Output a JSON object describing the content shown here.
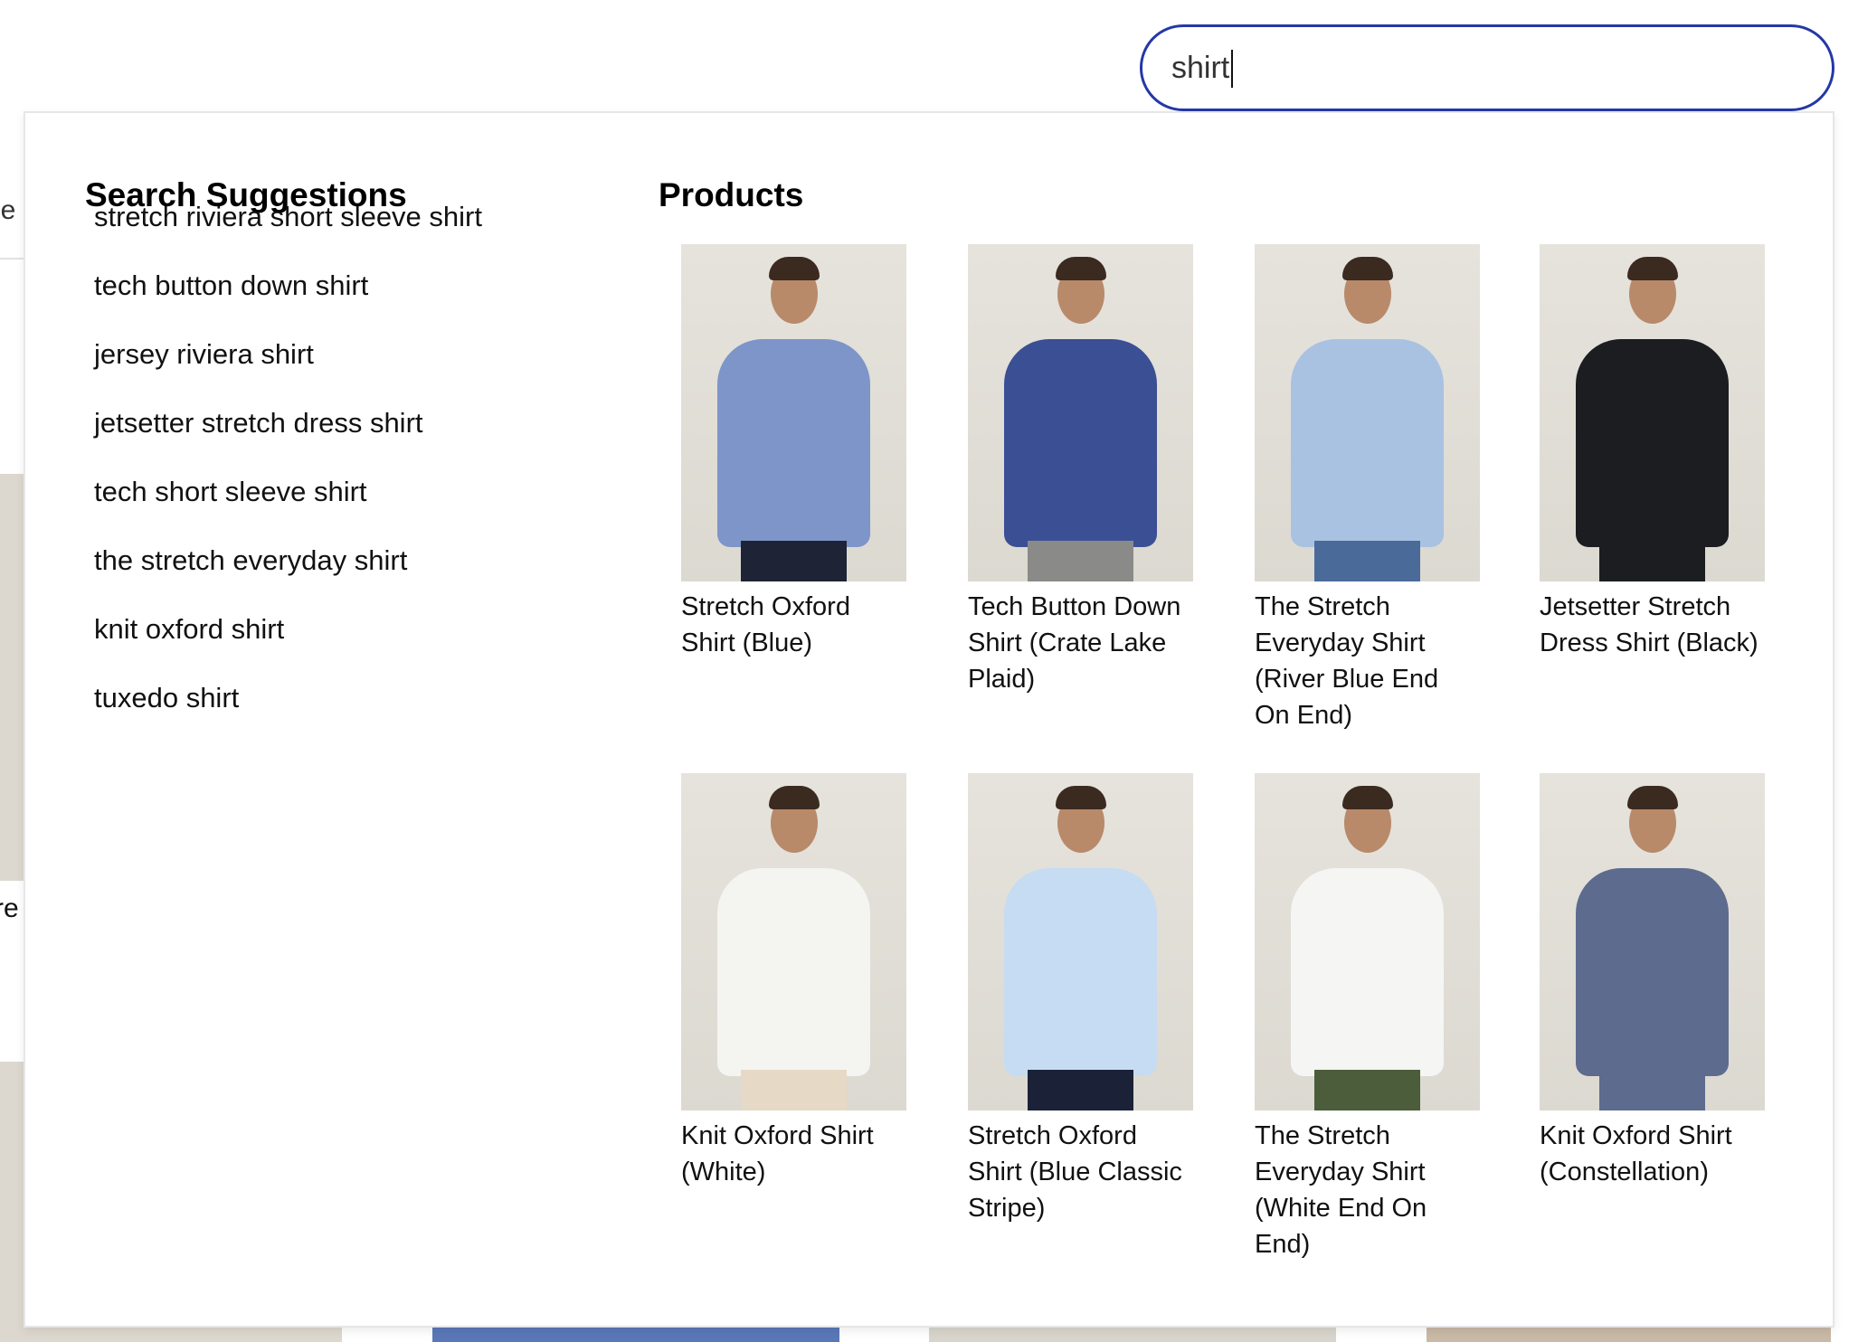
{
  "search": {
    "value": "shirt"
  },
  "background": {
    "partial_text_top": "le",
    "partial_text_mid": "re"
  },
  "suggestions": {
    "heading": "Search Suggestions",
    "items": [
      "stretch riviera short sleeve shirt",
      "tech button down shirt",
      "jersey riviera shirt",
      "jetsetter stretch dress shirt",
      "tech short sleeve shirt",
      "the stretch everyday shirt",
      "knit oxford shirt",
      "tuxedo shirt"
    ]
  },
  "products": {
    "heading": "Products",
    "items": [
      {
        "name": "Stretch Oxford Shirt (Blue)",
        "shirt_color": "#7d95c8",
        "pants_color": "#1e2436"
      },
      {
        "name": "Tech Button Down Shirt (Crate Lake Plaid)",
        "shirt_color": "#3b4f95",
        "pants_color": "#8a8a88"
      },
      {
        "name": "The Stretch Everyday Shirt (River Blue End On End)",
        "shirt_color": "#a9c2e2",
        "pants_color": "#4a6a9a"
      },
      {
        "name": "Jetsetter Stretch Dress Shirt (Black)",
        "shirt_color": "#1c1d20",
        "pants_color": "#1c1d20"
      },
      {
        "name": "Knit Oxford Shirt (White)",
        "shirt_color": "#f4f4f1",
        "pants_color": "#e6d9c6"
      },
      {
        "name": "Stretch Oxford Shirt (Blue Classic Stripe)",
        "shirt_color": "#c6dcf2",
        "pants_color": "#1b2238"
      },
      {
        "name": "The Stretch Everyday Shirt (White End On End)",
        "shirt_color": "#f5f5f3",
        "pants_color": "#4b5d3a"
      },
      {
        "name": "Knit Oxford Shirt (Constellation)",
        "shirt_color": "#5d6b8e",
        "pants_color": "#5d6b8e"
      }
    ]
  },
  "colors": {
    "accent": "#2438a6"
  }
}
